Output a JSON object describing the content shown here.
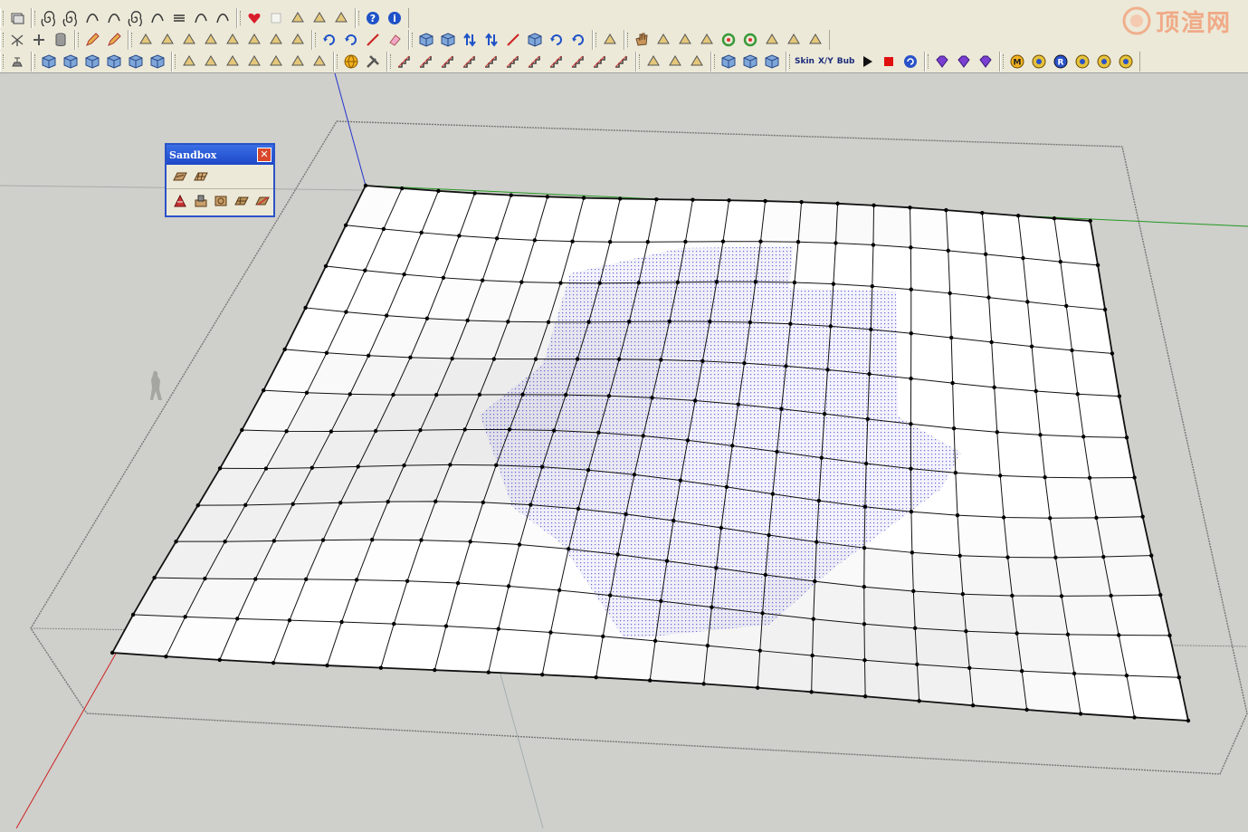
{
  "app": {
    "watermark_text": "顶渲网",
    "colors": {
      "toolbar_bg": "#ece9d8",
      "viewport_bg": "#cfcfcb",
      "axis_red": "#cc2222",
      "axis_green": "#229922",
      "axis_blue": "#2233cc",
      "selection_fill": "#3a3acc",
      "titlebar_blue": "#2553d0"
    }
  },
  "toolbars": {
    "row1": [
      {
        "icon": "layers-icon"
      },
      {
        "icon": "spiral-icon"
      },
      {
        "icon": "spiral-icon"
      },
      {
        "icon": "curve-icon"
      },
      {
        "icon": "curve-icon"
      },
      {
        "icon": "spiral-icon"
      },
      {
        "icon": "curve-icon"
      },
      {
        "icon": "coil-icon"
      },
      {
        "icon": "curve-icon"
      },
      {
        "icon": "curve-icon"
      },
      {
        "icon": "heart-icon"
      },
      {
        "icon": "blank-icon"
      },
      {
        "icon": "shape-icon"
      },
      {
        "icon": "shape-icon"
      },
      {
        "icon": "shape-icon"
      },
      {
        "icon": "help-icon"
      },
      {
        "icon": "info-icon"
      }
    ],
    "row2": [
      {
        "icon": "axes-icon"
      },
      {
        "icon": "plus-icon"
      },
      {
        "icon": "cylinder-icon"
      },
      {
        "icon": "pencil-icon"
      },
      {
        "icon": "pencil-icon"
      },
      {
        "icon": "shape-icon"
      },
      {
        "icon": "shape-icon"
      },
      {
        "icon": "shape-icon"
      },
      {
        "icon": "shape-icon"
      },
      {
        "icon": "shape-icon"
      },
      {
        "icon": "shape-icon"
      },
      {
        "icon": "shape-icon"
      },
      {
        "icon": "shape-icon"
      },
      {
        "icon": "rotate-icon"
      },
      {
        "icon": "rotate-icon"
      },
      {
        "icon": "line-icon"
      },
      {
        "icon": "eraser-icon"
      },
      {
        "icon": "cube-icon"
      },
      {
        "icon": "cube-icon"
      },
      {
        "icon": "arrows-icon"
      },
      {
        "icon": "arrows-icon"
      },
      {
        "icon": "line-icon"
      },
      {
        "icon": "cube-icon"
      },
      {
        "icon": "rotate-icon"
      },
      {
        "icon": "rotate-icon"
      },
      {
        "icon": "shape-icon"
      },
      {
        "icon": "hand-icon"
      },
      {
        "icon": "shape-icon"
      },
      {
        "icon": "shape-icon"
      },
      {
        "icon": "shape-icon"
      },
      {
        "icon": "ring-icon"
      },
      {
        "icon": "ring-icon"
      },
      {
        "icon": "shape-icon"
      },
      {
        "icon": "shape-icon"
      },
      {
        "icon": "shape-icon"
      }
    ],
    "row3": [
      {
        "icon": "lamp-icon"
      },
      {
        "icon": "cube-icon"
      },
      {
        "icon": "cube-icon"
      },
      {
        "icon": "cube-icon"
      },
      {
        "icon": "cube-icon"
      },
      {
        "icon": "cube-icon"
      },
      {
        "icon": "cube-icon"
      },
      {
        "icon": "shape-icon"
      },
      {
        "icon": "shape-icon"
      },
      {
        "icon": "shape-icon"
      },
      {
        "icon": "shape-icon"
      },
      {
        "icon": "shape-icon"
      },
      {
        "icon": "shape-icon"
      },
      {
        "icon": "shape-icon"
      },
      {
        "icon": "globe-icon"
      },
      {
        "icon": "tools-icon"
      },
      {
        "icon": "stair-icon"
      },
      {
        "icon": "stair-icon"
      },
      {
        "icon": "stair-icon"
      },
      {
        "icon": "stair-icon"
      },
      {
        "icon": "stair-icon"
      },
      {
        "icon": "stair-icon"
      },
      {
        "icon": "stair-icon"
      },
      {
        "icon": "stair-icon"
      },
      {
        "icon": "stair-icon"
      },
      {
        "icon": "stair-icon"
      },
      {
        "icon": "stair-icon"
      },
      {
        "icon": "shape-icon"
      },
      {
        "icon": "shape-icon"
      },
      {
        "icon": "shape-icon"
      },
      {
        "icon": "cube-icon"
      },
      {
        "icon": "cube-icon"
      },
      {
        "icon": "cube-icon"
      },
      {
        "icon": "skin-icon",
        "label": "Skin"
      },
      {
        "icon": "xy-icon",
        "label": "X/Y"
      },
      {
        "icon": "bub-icon",
        "label": "Bub"
      },
      {
        "icon": "play-icon"
      },
      {
        "icon": "stop-icon"
      },
      {
        "icon": "refresh-icon"
      },
      {
        "icon": "gem-icon"
      },
      {
        "icon": "gem-icon"
      },
      {
        "icon": "gem-icon"
      },
      {
        "icon": "m-badge-icon"
      },
      {
        "icon": "badge-icon"
      },
      {
        "icon": "r-badge-icon"
      },
      {
        "icon": "badge-icon"
      },
      {
        "icon": "badge-icon"
      },
      {
        "icon": "badge-icon"
      }
    ]
  },
  "sandbox_palette": {
    "title": "Sandbox",
    "close_label": "✕",
    "row1": [
      {
        "icon": "terrain-contour-icon"
      },
      {
        "icon": "terrain-grid-icon"
      }
    ],
    "row2": [
      {
        "icon": "smoove-icon"
      },
      {
        "icon": "stamp-icon"
      },
      {
        "icon": "drape-icon"
      },
      {
        "icon": "add-detail-icon"
      },
      {
        "icon": "flip-edge-icon"
      }
    ]
  },
  "model": {
    "grid_cols": 20,
    "grid_rows": 12,
    "selected_region": "center"
  }
}
